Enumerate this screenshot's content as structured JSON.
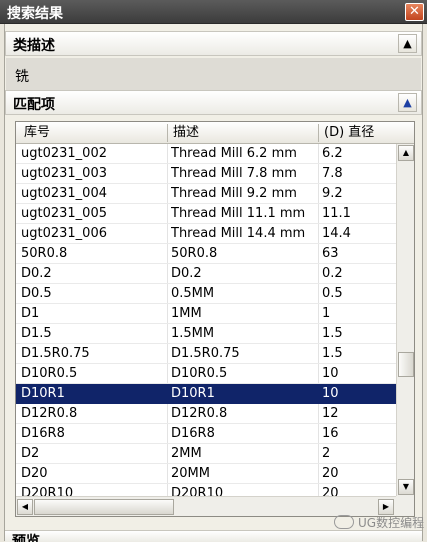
{
  "window": {
    "title": "搜索结果",
    "close_glyph": "✕"
  },
  "category_section": {
    "title": "类描述",
    "value": "铣",
    "collapse_glyph": "▲"
  },
  "match_section": {
    "title": "匹配项",
    "collapse_glyph": "▲"
  },
  "table": {
    "columns": [
      "库号",
      "描述",
      "(D) 直径"
    ],
    "rows": [
      [
        "ugt0231_002",
        "Thread Mill 6.2 mm",
        "6.2"
      ],
      [
        "ugt0231_003",
        "Thread Mill 7.8 mm",
        "7.8"
      ],
      [
        "ugt0231_004",
        "Thread Mill 9.2 mm",
        "9.2"
      ],
      [
        "ugt0231_005",
        "Thread Mill 11.1 mm",
        "11.1"
      ],
      [
        "ugt0231_006",
        "Thread Mill 14.4 mm",
        "14.4"
      ],
      [
        "50R0.8",
        "50R0.8",
        "63"
      ],
      [
        "D0.2",
        "D0.2",
        "0.2"
      ],
      [
        "D0.5",
        "0.5MM",
        "0.5"
      ],
      [
        "D1",
        "1MM",
        "1"
      ],
      [
        "D1.5",
        "1.5MM",
        "1.5"
      ],
      [
        "D1.5R0.75",
        "D1.5R0.75",
        "1.5"
      ],
      [
        "D10R0.5",
        "D10R0.5",
        "10"
      ],
      [
        "D10R1",
        "D10R1",
        "10"
      ],
      [
        "D12R0.8",
        "D12R0.8",
        "12"
      ],
      [
        "D16R8",
        "D16R8",
        "16"
      ],
      [
        "D2",
        "2MM",
        "2"
      ],
      [
        "D20",
        "20MM",
        "20"
      ],
      [
        "D20R10",
        "D20R10",
        "20"
      ]
    ],
    "selected_row": 12
  },
  "scrollbar": {
    "up": "▲",
    "down": "▼",
    "left": "◀",
    "right": "▶"
  },
  "preview_section": {
    "title": "预览"
  },
  "watermark": {
    "text": "UG数控编程"
  },
  "colors": {
    "selection": "#102469",
    "title_bar": "#4a4a4a",
    "close_button": "#d2562f"
  }
}
